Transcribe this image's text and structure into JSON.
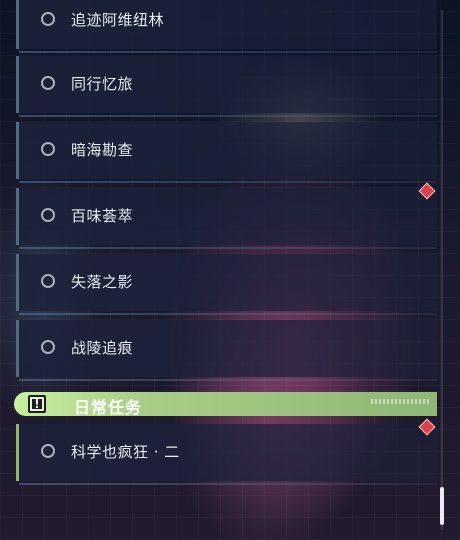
{
  "quests": [
    {
      "label": "追迹阿维纽林"
    },
    {
      "label": "同行忆旅"
    },
    {
      "label": "暗海勘查"
    },
    {
      "label": "百味荟萃"
    },
    {
      "label": "失落之影"
    },
    {
      "label": "战陵追痕"
    }
  ],
  "daily_section": {
    "title": "日常任务",
    "icon": "alert-square-icon"
  },
  "daily_quests": [
    {
      "label": "科学也疯狂 · 二"
    }
  ],
  "colors": {
    "quest_border": "#4f6e86",
    "daily_border": "#8fb670",
    "section_green": "#a8cd88",
    "marker_red": "#d9434c"
  },
  "icons": {
    "quest_status": "empty-circle-icon",
    "tracking_marker": "diamond-marker-icon"
  }
}
